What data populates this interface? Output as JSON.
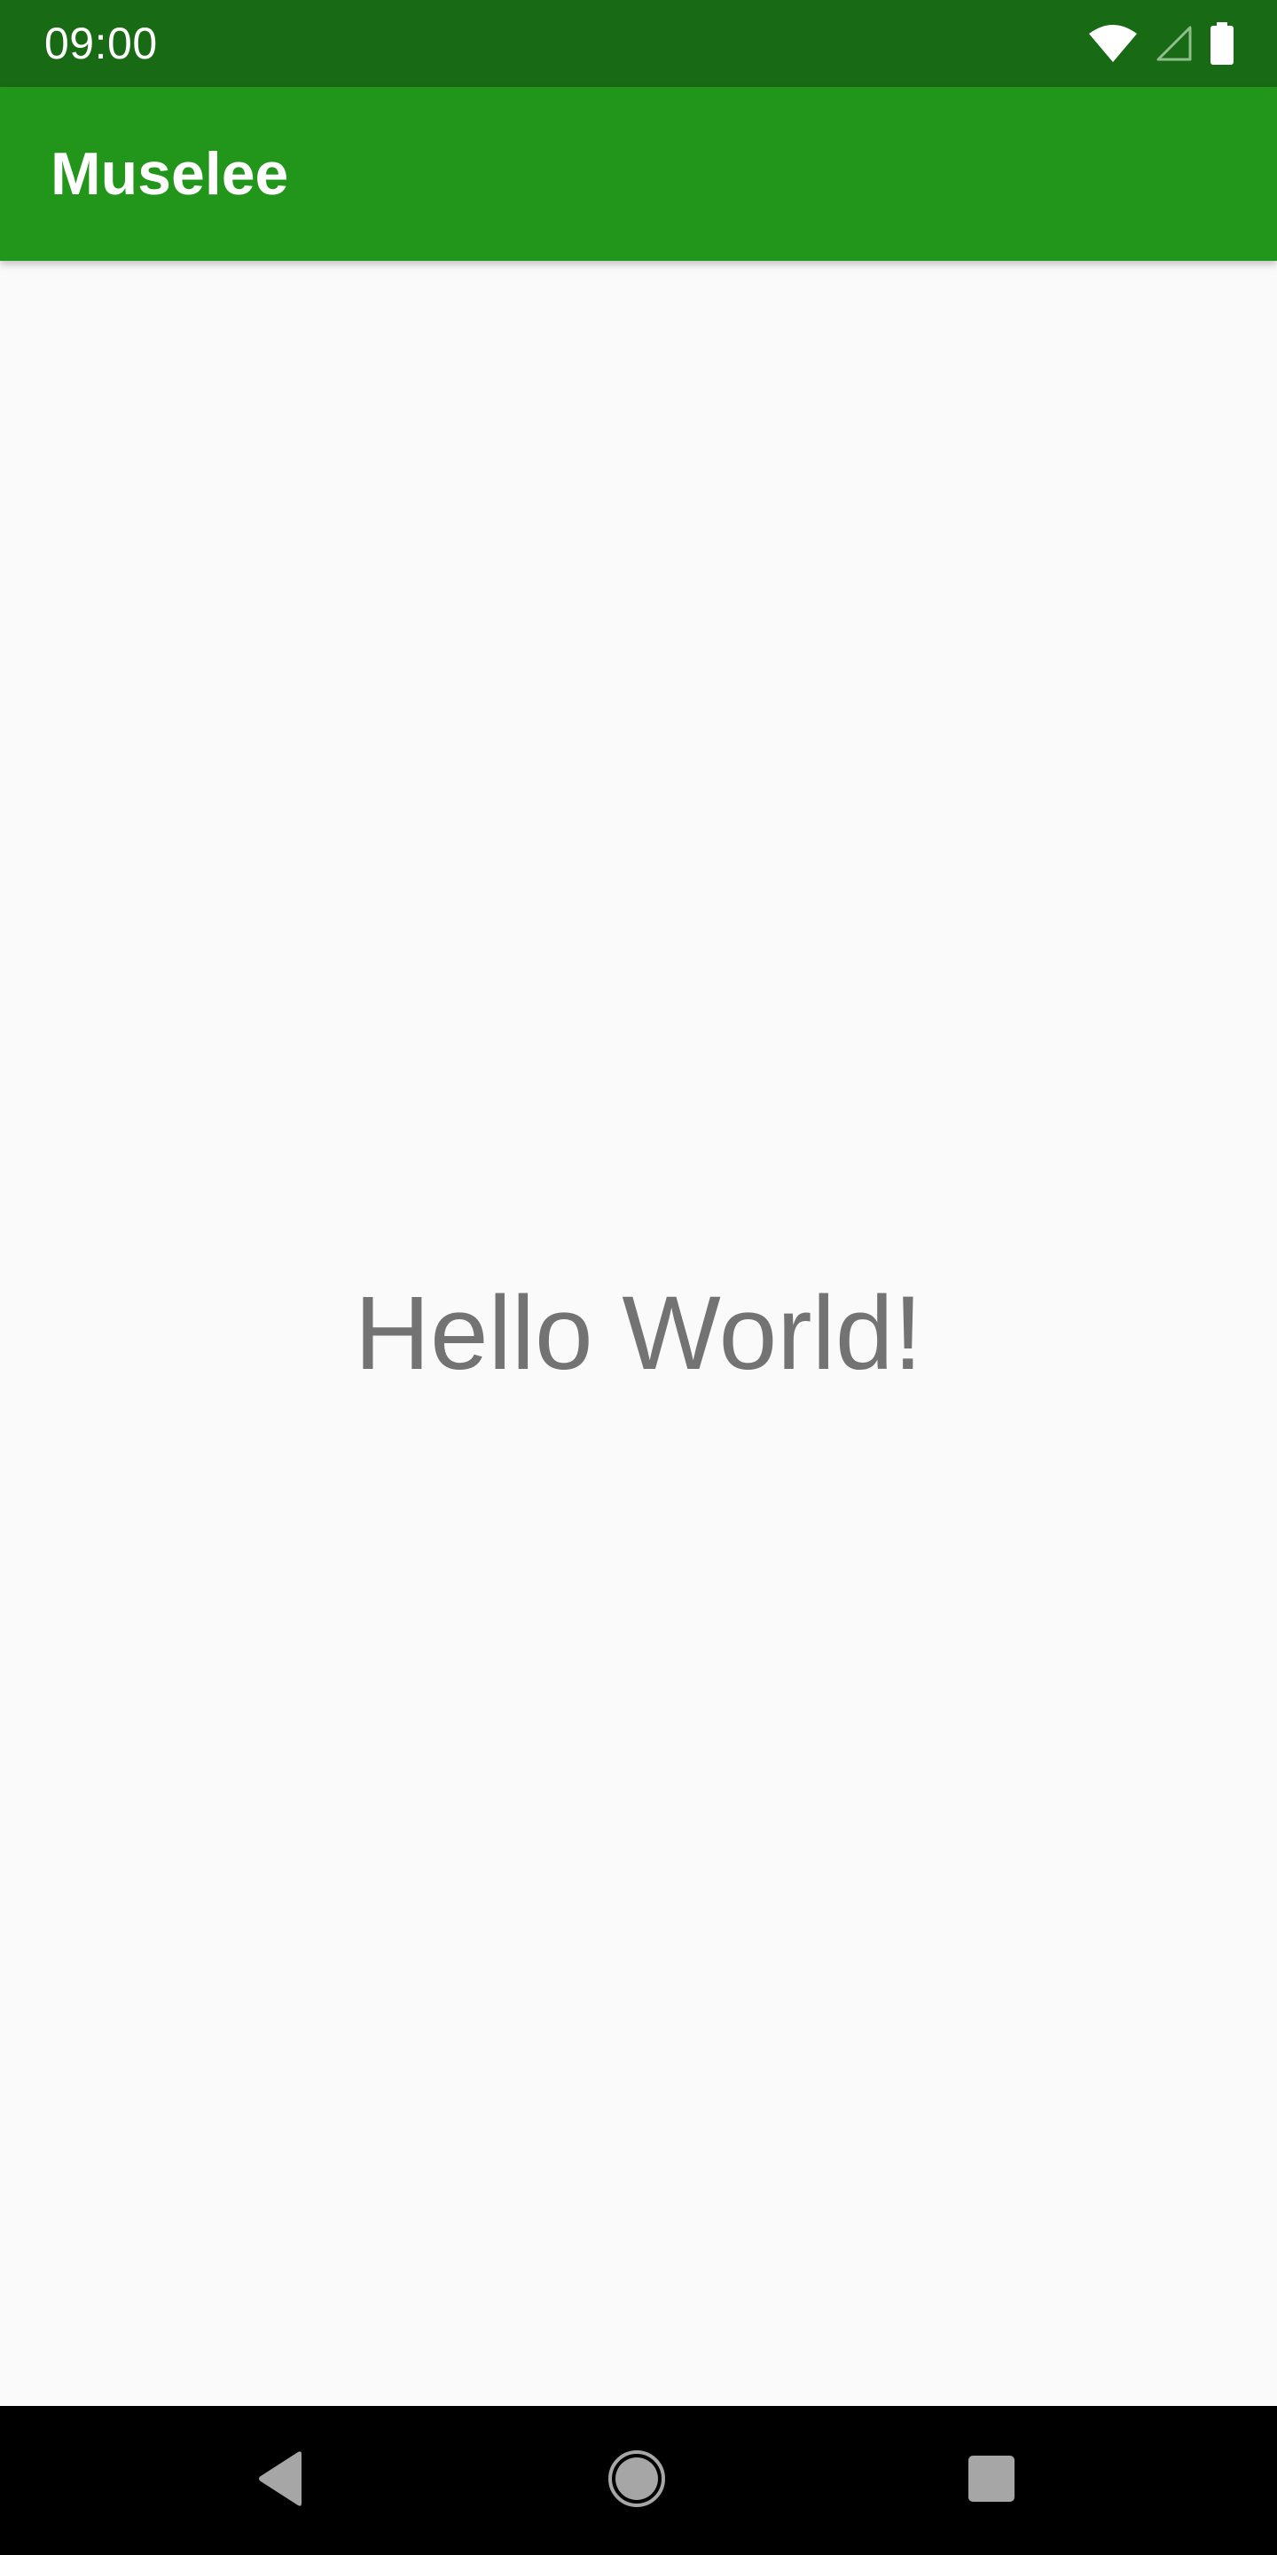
{
  "status_bar": {
    "time": "09:00",
    "icons": [
      "wifi-icon",
      "cellular-signal-icon",
      "battery-icon"
    ]
  },
  "app_bar": {
    "title": "Muselee"
  },
  "main": {
    "text": "Hello World!"
  },
  "nav_bar": {
    "buttons": [
      "back-icon",
      "home-icon",
      "recents-icon"
    ]
  },
  "colors": {
    "status_bar": "#196a15",
    "app_bar": "#21961a",
    "background": "#fafafa",
    "text": "#737373",
    "nav_bar": "#000000"
  }
}
